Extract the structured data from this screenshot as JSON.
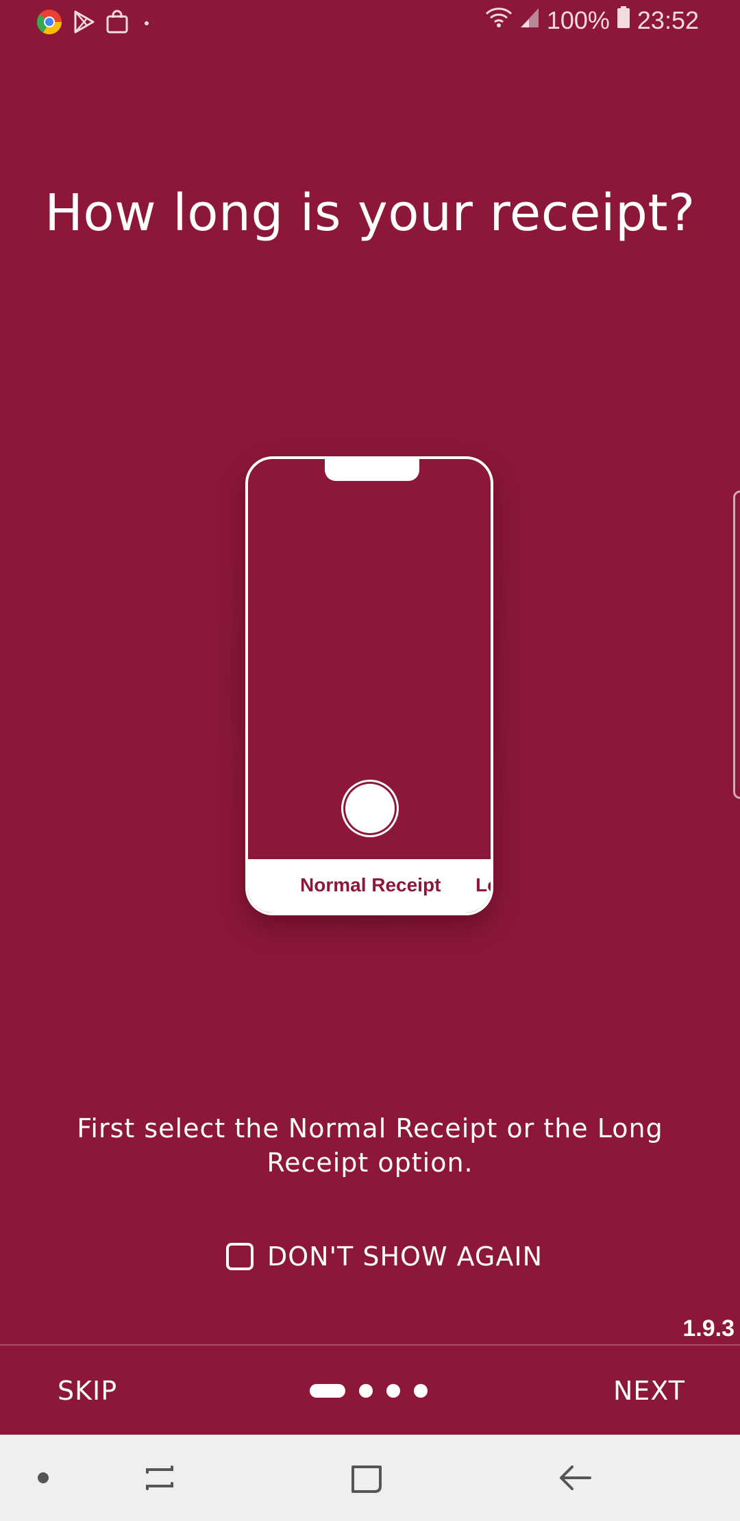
{
  "status_bar": {
    "battery": "100%",
    "time": "23:52",
    "left_icons": [
      "chrome-icon",
      "play-store-icon",
      "shopping-bag-icon",
      "dot-icon"
    ],
    "right_icons": [
      "wifi-icon",
      "signal-icon",
      "battery-icon"
    ]
  },
  "title": "How long is your receipt?",
  "illustration": {
    "mode_normal": "Normal Receipt",
    "mode_long": "Lo"
  },
  "description": "First select the Normal Receipt or the Long Receipt option.",
  "dont_show_again": {
    "label": "DON'T SHOW AGAIN",
    "checked": false
  },
  "version": "1.9.3",
  "footer": {
    "skip": "SKIP",
    "next": "NEXT",
    "page_count": 4,
    "current_page": 1
  },
  "nav_bar": {
    "items": [
      "dot-icon",
      "recents-icon",
      "home-icon",
      "back-icon"
    ]
  },
  "colors": {
    "background": "#8C1739",
    "foreground": "#FFFFFF",
    "nav_background": "#EFEFEF"
  }
}
